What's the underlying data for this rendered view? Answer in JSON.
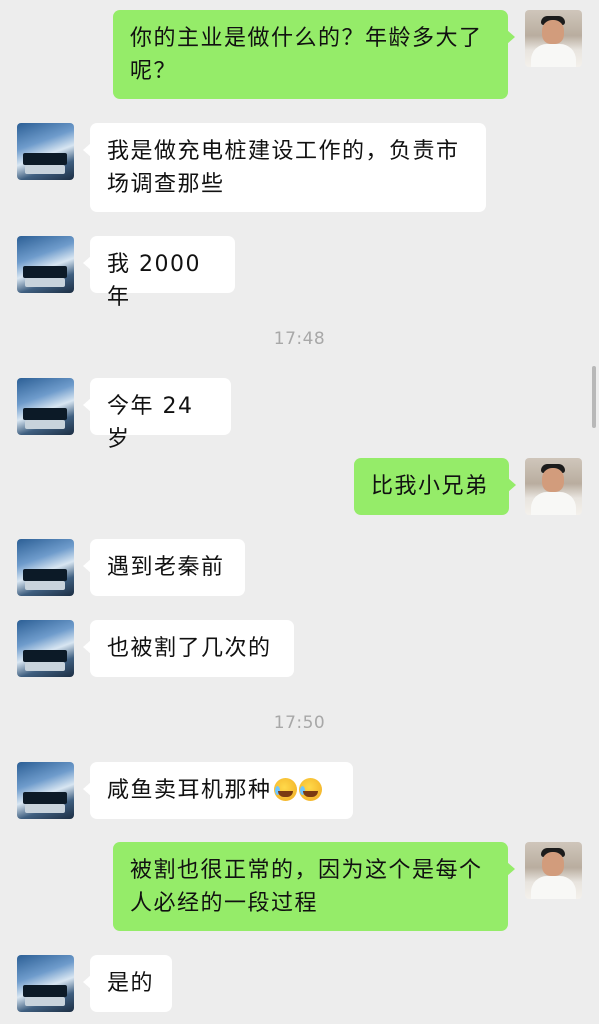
{
  "messages": [
    {
      "side": "right",
      "text": "你的主业是做什么的？年龄多大了呢？",
      "line1": "你的主业是做什么的？年龄多大了",
      "line2": "呢？"
    },
    {
      "side": "left",
      "line1": "我是做充电桩建设工作的，负责市",
      "line2": "场调查那些"
    },
    {
      "side": "left",
      "text": "我 2000 年"
    },
    {
      "time": "17:48"
    },
    {
      "side": "left",
      "text": "今年 24 岁"
    },
    {
      "side": "right",
      "text": "比我小兄弟"
    },
    {
      "side": "left",
      "text": "遇到老秦前"
    },
    {
      "side": "left",
      "text": "也被割了几次的"
    },
    {
      "time": "17:50"
    },
    {
      "side": "left",
      "text": "咸鱼卖耳机那种",
      "emojis": [
        "crying-laughing-emoji",
        "crying-laughing-emoji"
      ]
    },
    {
      "side": "right",
      "line1": "被割也很正常的，因为这个是每个",
      "line2": "人必经的一段过程"
    },
    {
      "side": "left",
      "text": "是的"
    }
  ],
  "colors": {
    "background": "#ededed",
    "sent_bubble": "#95ec69",
    "received_bubble": "#ffffff",
    "timestamp": "#a8a8a8"
  }
}
